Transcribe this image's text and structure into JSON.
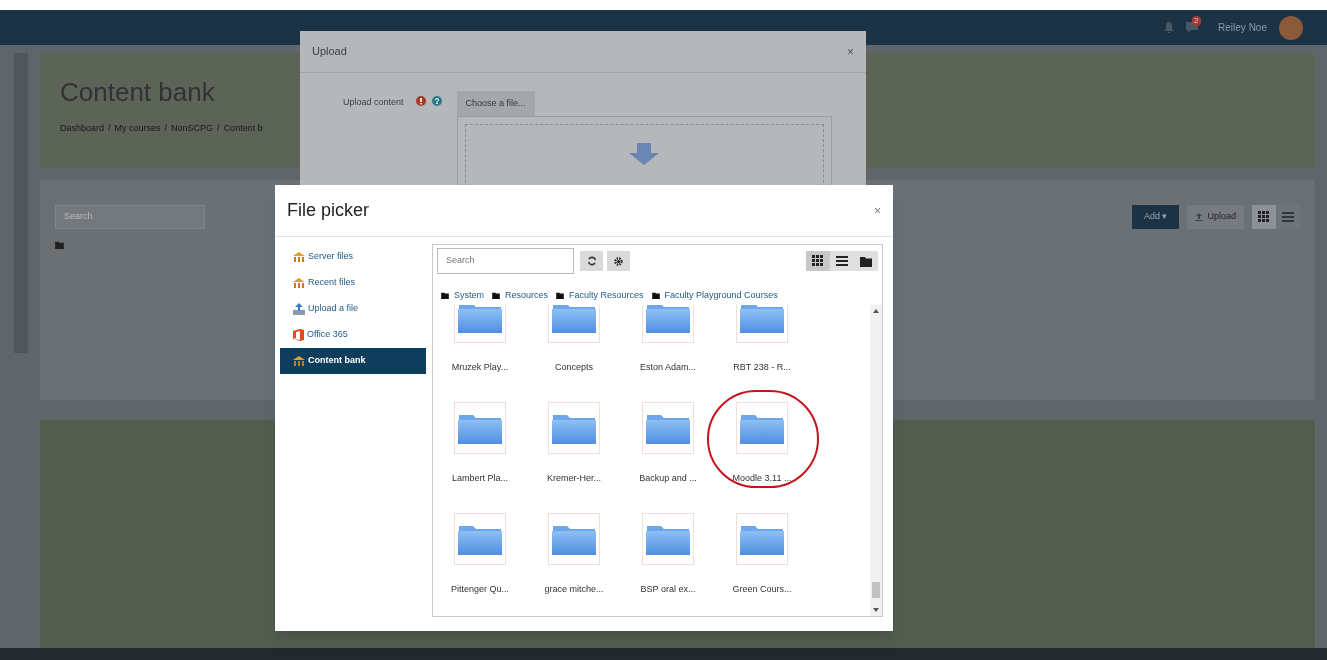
{
  "topbar": {
    "notification_badge": "2",
    "user_name": "Reiley Noe"
  },
  "page": {
    "title": "Content bank",
    "breadcrumb": [
      "Dashboard",
      "My courses",
      "NonSCPG",
      "Content b"
    ],
    "breadcrumb_separator": "/",
    "add_caret": "▾",
    "search": {
      "placeholder": "Search"
    },
    "add_button": "Add",
    "upload_button": "Upload",
    "views": [
      {
        "kind": "grid",
        "selected": true
      },
      {
        "kind": "list",
        "selected": false
      }
    ]
  },
  "upload_dialog": {
    "title": "Upload",
    "close": "×",
    "field_label": "Upload content",
    "choose_button": "Choose a file..."
  },
  "file_picker": {
    "title": "File picker",
    "close": "×",
    "repositories": [
      {
        "label": "Server files",
        "kind": "server",
        "selected": false
      },
      {
        "label": "Recent files",
        "kind": "server",
        "selected": false
      },
      {
        "label": "Upload a file",
        "kind": "upload",
        "selected": false
      },
      {
        "label": "Office 365",
        "kind": "office",
        "selected": false
      },
      {
        "label": "Content bank",
        "kind": "server",
        "selected": true
      }
    ],
    "search": {
      "placeholder": "Search"
    },
    "views": [
      {
        "kind": "grid",
        "selected": true
      },
      {
        "kind": "list",
        "selected": false
      },
      {
        "kind": "tree",
        "selected": false
      }
    ],
    "path": [
      "System",
      "Resources",
      "Faculty Resources",
      "Faculty Playground Courses"
    ],
    "folders": [
      {
        "label": "Mruzek Play...",
        "highlighted": false
      },
      {
        "label": "Concepts",
        "highlighted": false
      },
      {
        "label": "Eston Adam...",
        "highlighted": false
      },
      {
        "label": "RBT 238 - R...",
        "highlighted": false
      },
      {
        "label": "Lambert Pla...",
        "highlighted": false
      },
      {
        "label": "Kremer-Her...",
        "highlighted": false
      },
      {
        "label": "Backup and ...",
        "highlighted": false
      },
      {
        "label": "Moodle 3.11 ...",
        "highlighted": true
      },
      {
        "label": "Pittenger Qu...",
        "highlighted": false
      },
      {
        "label": "grace mitche...",
        "highlighted": false
      },
      {
        "label": "BSP oral ex...",
        "highlighted": false
      },
      {
        "label": "Green Cours...",
        "highlighted": false
      }
    ]
  }
}
